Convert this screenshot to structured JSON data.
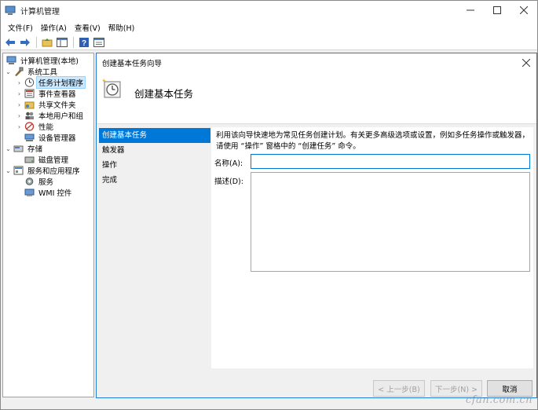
{
  "window": {
    "title": "计算机管理",
    "controls": [
      "minimize",
      "maximize",
      "close"
    ]
  },
  "menu": [
    "文件(F)",
    "操作(A)",
    "查看(V)",
    "帮助(H)"
  ],
  "toolbar": {
    "buttons": [
      "back-arrow-icon",
      "forward-arrow-icon",
      "folder-up-icon",
      "console-tree-icon",
      "help-icon",
      "properties-icon"
    ]
  },
  "tree": {
    "root": "计算机管理(本地)",
    "system_tools": "系统工具",
    "items": [
      {
        "label": "任务计划程序",
        "selected": true
      },
      {
        "label": "事件查看器"
      },
      {
        "label": "共享文件夹"
      },
      {
        "label": "本地用户和组"
      },
      {
        "label": "性能"
      },
      {
        "label": "设备管理器"
      }
    ],
    "storage": "存储",
    "disk": "磁盘管理",
    "services_apps": "服务和应用程序",
    "services": "服务",
    "wmi": "WMI 控件"
  },
  "dialog": {
    "title": "创建基本任务向导",
    "header": "创建基本任务",
    "steps": [
      "创建基本任务",
      "触发器",
      "操作",
      "完成"
    ],
    "active_step": 0,
    "description": "利用该向导快速地为常见任务创建计划。有关更多高级选项或设置，例如多任务操作或触发器，请使用 “操作” 窗格中的 “创建任务” 命令。",
    "name_label": "名称(A):",
    "name_value": "",
    "desc_label": "描述(D):",
    "desc_value": "",
    "buttons": {
      "back": "< 上一步(B)",
      "next": "下一步(N) >",
      "cancel": "取消"
    }
  },
  "watermark": "cfan.com.cn",
  "colors": {
    "accent": "#0078d7",
    "selection": "#cce8ff"
  }
}
